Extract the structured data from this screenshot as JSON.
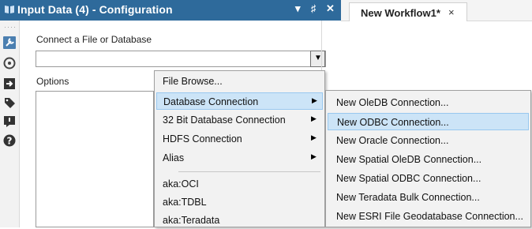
{
  "panel": {
    "title": "Input Data (4) - Configuration",
    "controls": {
      "dropdown": "▾",
      "pin": "♯",
      "close": "✕"
    }
  },
  "workflow_tab": {
    "label": "New Workflow1*",
    "close": "×"
  },
  "toolbar": {
    "icons": [
      "wrench-icon",
      "tool-palette-icon",
      "output-arrow-icon",
      "tag-icon",
      "annotation-icon",
      "help-icon"
    ]
  },
  "config": {
    "connect_label": "Connect a File or Database",
    "connect_value": "",
    "options_label": "Options"
  },
  "source_menu": {
    "items": [
      {
        "label": "File Browse...",
        "submenu": false
      },
      {
        "label": "Database Connection",
        "submenu": true,
        "highlighted": true
      },
      {
        "label": "32 Bit Database Connection",
        "submenu": true
      },
      {
        "label": "HDFS Connection",
        "submenu": true
      },
      {
        "label": "Alias",
        "submenu": true
      },
      {
        "label": "aka:OCI",
        "submenu": false
      },
      {
        "label": "aka:TDBL",
        "submenu": false
      },
      {
        "label": "aka:Teradata",
        "submenu": false
      }
    ],
    "arrow": "▶"
  },
  "db_submenu": {
    "items": [
      {
        "label": "New OleDB Connection..."
      },
      {
        "label": "New ODBC Connection...",
        "highlighted": true
      },
      {
        "label": "New Oracle Connection..."
      },
      {
        "label": "New Spatial OleDB Connection..."
      },
      {
        "label": "New Spatial ODBC Connection..."
      },
      {
        "label": "New Teradata Bulk Connection..."
      },
      {
        "label": "New ESRI File Geodatabase Connection..."
      }
    ]
  },
  "colors": {
    "title_bar": "#2e6a9b",
    "menu_bg": "#f2f2f2",
    "highlight": "#cce4f7"
  }
}
